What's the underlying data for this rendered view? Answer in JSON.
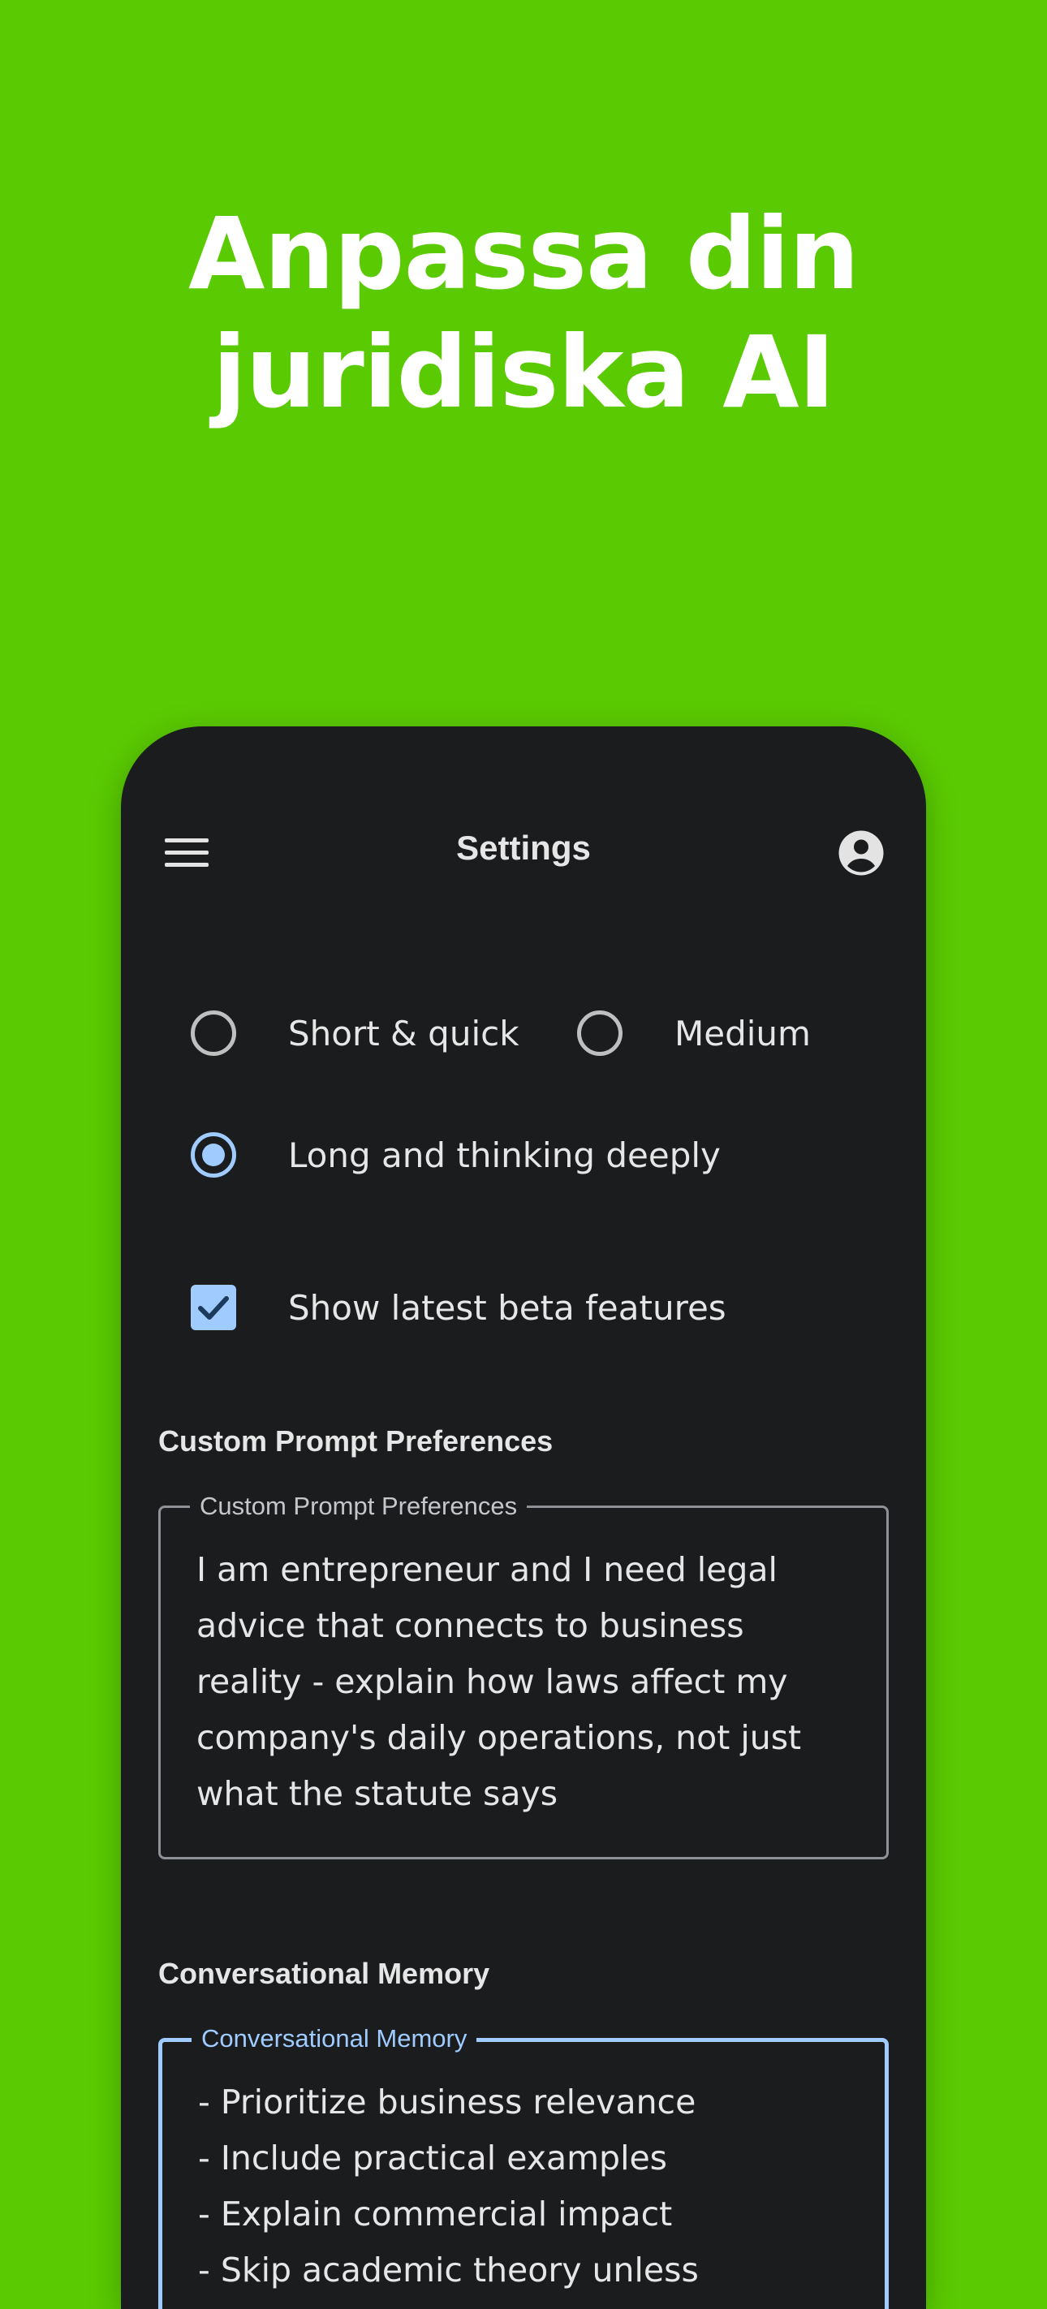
{
  "headline": {
    "line1": "Anpassa din",
    "line2": "juridiska AI"
  },
  "colors": {
    "background": "#5ACB02",
    "phone_surface": "#1B1C1E",
    "accent": "#9FCBFF"
  },
  "appbar": {
    "title": "Settings",
    "menu_icon": "hamburger-menu-icon",
    "account_icon": "account-circle-icon"
  },
  "response_length": {
    "options": [
      {
        "label": "Short & quick",
        "selected": false
      },
      {
        "label": "Medium",
        "selected": false
      },
      {
        "label": "Long and thinking deeply",
        "selected": true
      }
    ]
  },
  "beta": {
    "label": "Show latest beta features",
    "checked": true
  },
  "custom_prompt": {
    "section_title": "Custom Prompt Preferences",
    "field_label": "Custom Prompt Preferences",
    "value": "I am entrepreneur and I  need legal\nadvice that connects to business\nreality - explain how laws affect my\ncompany's daily operations, not just\nwhat the statute says"
  },
  "memory": {
    "section_title": "Conversational Memory",
    "field_label": "Conversational Memory",
    "value": "- Prioritize business relevance\n- Include practical examples\n- Explain commercial impact\n- Skip academic theory unless"
  }
}
